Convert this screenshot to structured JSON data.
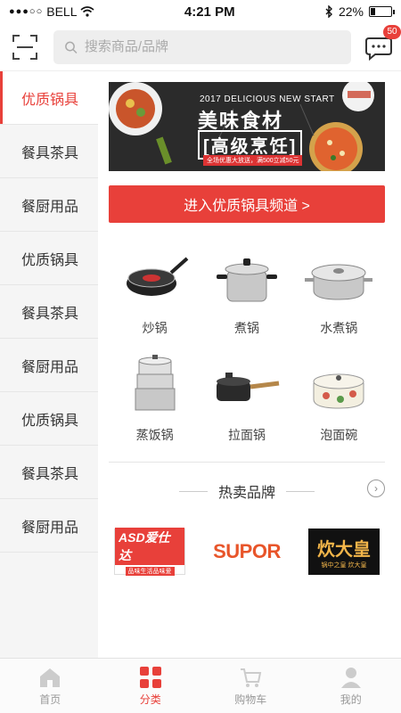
{
  "status_bar": {
    "carrier": "BELL",
    "time": "4:21 PM",
    "battery": "22%",
    "battery_level": 0.22
  },
  "header": {
    "search_placeholder": "搜索商品/品牌",
    "message_badge": "50"
  },
  "sidebar": {
    "items": [
      {
        "label": "优质锅具"
      },
      {
        "label": "餐具茶具"
      },
      {
        "label": "餐厨用品"
      },
      {
        "label": "优质锅具"
      },
      {
        "label": "餐具茶具"
      },
      {
        "label": "餐厨用品"
      },
      {
        "label": "优质锅具"
      },
      {
        "label": "餐具茶具"
      },
      {
        "label": "餐厨用品"
      }
    ]
  },
  "banner": {
    "subtitle_en": "2017 DELICIOUS NEW START",
    "title": "美味食材",
    "title2": "[高级烹饪]",
    "note": "全场优惠大放送，满500立减50元"
  },
  "enter_button": "进入优质锅具频道 >",
  "products": [
    {
      "label": "炒锅",
      "icon": "wok-icon"
    },
    {
      "label": "煮锅",
      "icon": "stockpot-icon"
    },
    {
      "label": "水煮锅",
      "icon": "soup-pot-icon"
    },
    {
      "label": "蒸饭锅",
      "icon": "steamer-icon"
    },
    {
      "label": "拉面锅",
      "icon": "saucepan-icon"
    },
    {
      "label": "泡面碗",
      "icon": "enamel-pot-icon"
    }
  ],
  "brands_section": {
    "title": "热卖品牌",
    "brands": [
      {
        "name": "ASD爱仕达",
        "tagline": "品味生活品味爱"
      },
      {
        "name": "SUPOR"
      },
      {
        "name": "炊大皇",
        "tagline": "锅中之皇 炊大皇"
      }
    ]
  },
  "tabbar": {
    "tabs": [
      {
        "label": "首页"
      },
      {
        "label": "分类"
      },
      {
        "label": "购物车"
      },
      {
        "label": "我的"
      }
    ]
  },
  "colors": {
    "accent": "#e8403a",
    "sidebar_bg": "#f5f5f5"
  }
}
